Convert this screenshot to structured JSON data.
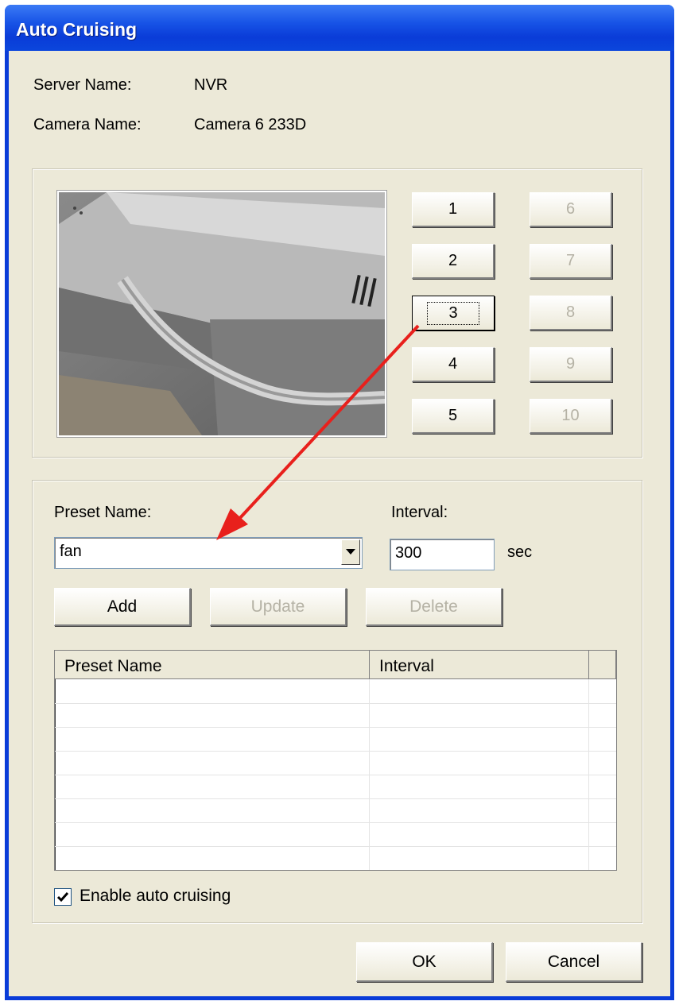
{
  "window": {
    "title": "Auto Cruising"
  },
  "info": {
    "server_label": "Server Name:",
    "server_value": "NVR",
    "camera_label": "Camera Name:",
    "camera_value": "Camera 6 233D"
  },
  "presets": {
    "buttons": [
      {
        "label": "1",
        "enabled": true
      },
      {
        "label": "2",
        "enabled": true
      },
      {
        "label": "3",
        "enabled": true,
        "focused": true
      },
      {
        "label": "4",
        "enabled": true
      },
      {
        "label": "5",
        "enabled": true
      },
      {
        "label": "6",
        "enabled": false
      },
      {
        "label": "7",
        "enabled": false
      },
      {
        "label": "8",
        "enabled": false
      },
      {
        "label": "9",
        "enabled": false
      },
      {
        "label": "10",
        "enabled": false
      }
    ]
  },
  "form": {
    "preset_name_label": "Preset Name:",
    "preset_name_value": "fan",
    "interval_label": "Interval:",
    "interval_value": "300",
    "interval_unit": "sec",
    "add_label": "Add",
    "update_label": "Update",
    "delete_label": "Delete"
  },
  "table": {
    "columns": [
      "Preset Name",
      "Interval"
    ],
    "rows": []
  },
  "enable_auto_cruising": {
    "label": "Enable auto cruising",
    "checked": true
  },
  "footer": {
    "ok_label": "OK",
    "cancel_label": "Cancel"
  },
  "colors": {
    "title_bar": "#0a3cd8",
    "dialog_bg": "#ece9d8",
    "annotation_arrow": "#e8201c"
  }
}
